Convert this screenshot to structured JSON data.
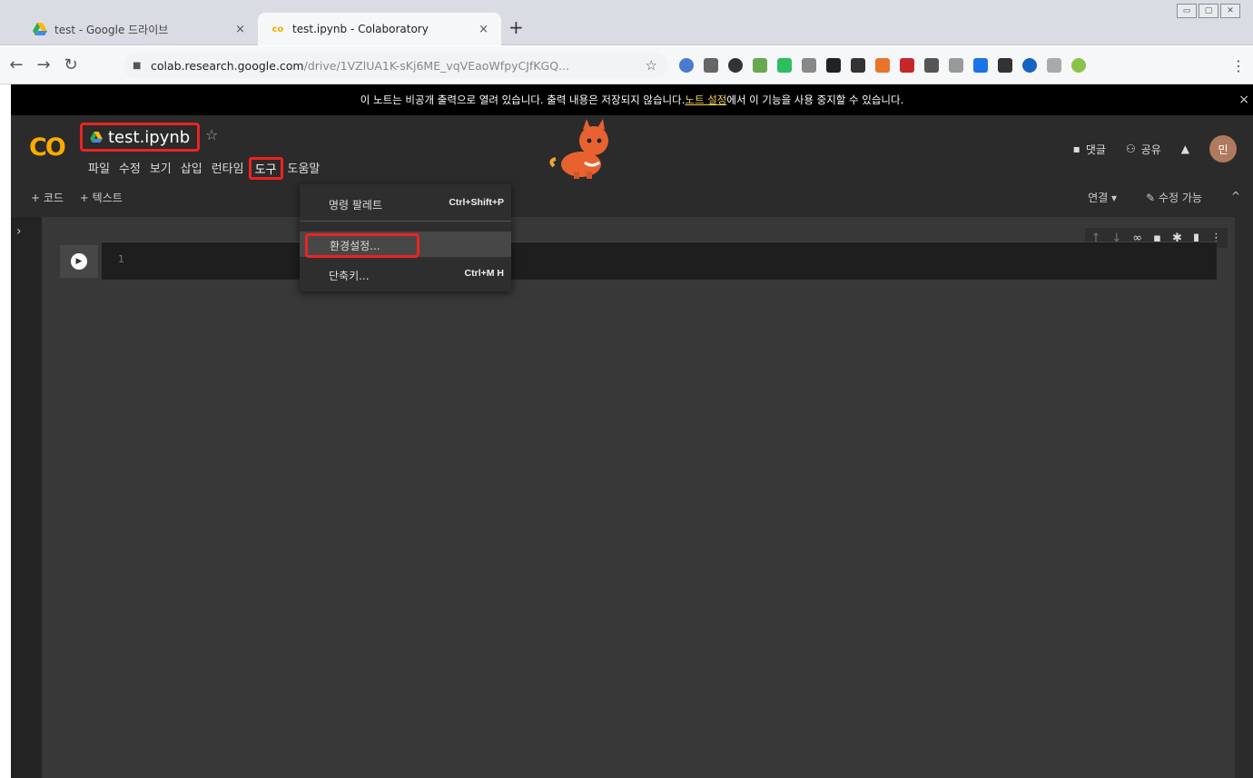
{
  "browser": {
    "tabs": [
      {
        "title": "test - Google 드라이브",
        "icon": "google-drive-icon",
        "close": "×",
        "active": false
      },
      {
        "title": "test.ipynb - Colaboratory",
        "icon": "colab-icon",
        "close": "×",
        "active": true
      }
    ],
    "new_tab": "+",
    "window_controls": [
      "▭",
      "▢",
      "✕"
    ],
    "url_host": "colab.research.google.com",
    "url_path": "/drive/1VZlUA1K-sKj6ME_vqVEaoWfpyCJfKGQ...",
    "star": "☆",
    "menu": "⋮"
  },
  "banner": {
    "text_before": "이 노트는 비공개 출력으로 열려 있습니다. 출력 내용은 저장되지 않습니다. ",
    "link": "노트 설정",
    "text_after": "에서 이 기능을 사용 중지할 수 있습니다.",
    "close": "×"
  },
  "colab": {
    "logo": "CO",
    "notebook_title": "test.ipynb",
    "star": "☆",
    "menu": [
      "파일",
      "수정",
      "보기",
      "삽입",
      "런타임",
      "도구",
      "도움말"
    ],
    "highlighted_menu": "도구",
    "header_right": {
      "comment_label": "댓글",
      "share_label": "공유",
      "avatar": "민"
    },
    "add_code": "+ 코드",
    "add_text": "+ 텍스트",
    "connect": "연결 ▾",
    "editing": "수정 가능",
    "collapse": "^"
  },
  "cell": {
    "line_number": "1"
  },
  "tools_dropdown": {
    "items": [
      {
        "label": "명령 팔레트",
        "shortcut": "Ctrl+Shift+P"
      },
      {
        "label": "환경설정...",
        "shortcut": "",
        "selected": true
      },
      {
        "label": "단축키...",
        "shortcut": "Ctrl+M H"
      }
    ]
  },
  "colors": {
    "accent": "#f9ab00",
    "highlight": "#e22222",
    "background": "#383838"
  }
}
